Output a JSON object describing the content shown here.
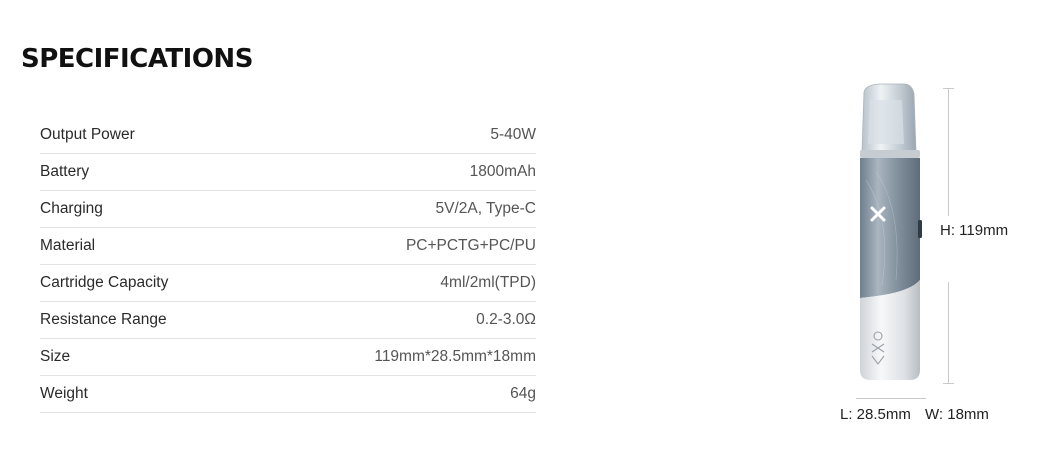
{
  "title": "SPECIFICATIONS",
  "specs": [
    {
      "label": "Output Power",
      "value": "5-40W"
    },
    {
      "label": "Battery",
      "value": "1800mAh"
    },
    {
      "label": "Charging",
      "value": "5V/2A, Type-C"
    },
    {
      "label": "Material",
      "value": "PC+PCTG+PC/PU"
    },
    {
      "label": "Cartridge Capacity",
      "value": "4ml/2ml(TPD)"
    },
    {
      "label": "Resistance Range",
      "value": "0.2-3.0Ω"
    },
    {
      "label": "Size",
      "value": "119mm*28.5mm*18mm"
    },
    {
      "label": "Weight",
      "value": "64g"
    }
  ],
  "dimensions": {
    "height": "H: 119mm",
    "length": "L: 28.5mm",
    "width": "W: 18mm"
  },
  "colors": {
    "device_body": "#8a98a6",
    "device_bottom": "#e4e6e8",
    "device_cap": "#cfd6db",
    "logo": "#ffffff"
  }
}
